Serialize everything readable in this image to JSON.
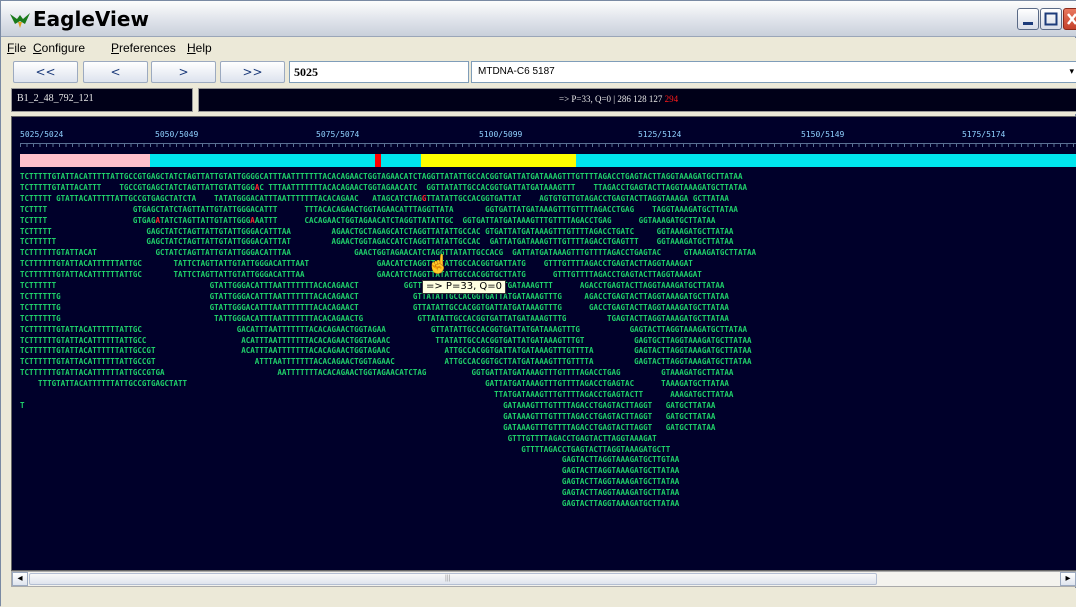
{
  "window": {
    "title": "EagleView"
  },
  "menu": {
    "file": "File",
    "configure": "Configure",
    "preferences": "Preferences",
    "help": "Help"
  },
  "nav": {
    "first_label": "<<",
    "prev_label": "<",
    "next_label": ">",
    "last_label": ">>",
    "position_value": "5025",
    "reference_value": "MTDNA-C6 5187"
  },
  "info": {
    "read_id": "B1_2_48_792_121",
    "status_main": "=> P=33, Q=0 |  286 128 127 ",
    "status_highlight": "294"
  },
  "positions": [
    "5025/5024",
    "5050/5049",
    "5075/5074",
    "5100/5099",
    "5125/5124",
    "5150/5149",
    "5175/5174"
  ],
  "coverage_colors": {
    "pink": "#ffc0cb",
    "cyan": "#00e5ee",
    "red": "#ff0000",
    "yellow": "#ffff00"
  },
  "tooltip": "=> P=33, Q=0",
  "reads": [
    {
      "t": "TCTTTTTGTATTACATTTTTATTGCCGTGAGCTATCTAGTTATTGTATTGGGGCATTTAATTTTTTTACACAGAACTGGTAGAACATCTAGGTTATATTGCCACGGTGATTATGATAAAGTTTGTTTTAGACCTGAGTACTTAGGTAAAGATGCTTATAA"
    },
    {
      "t": "TCTTTTTGTATTACATTT    TGCCGTGAGCTATCTAGTTATTGTATTGGGAC TTTAATTTTTTTACACAGAACTGGTAGAACATC  GGTTATATTGCCACGGTGATTATGATAAAGTTT    TTAGACCTGAGTACTTAGGTAAAGATGCTTATAA",
      "mm": [
        52
      ]
    },
    {
      "t": "TCTTTTT GTATTACATTTTTATTGCCGTGAGCTATCTA    TATATGGGACATTTAATTTTTTTACACAGAAC   ATAGCATCTAGGTTATATTGCCACGGTGATTAT    AGTGTGTTGTAGACCTGAGTACTTAGGTAAAGA GCTTATAA",
      "mm": [
        42,
        89
      ]
    },
    {
      "t": "TCTTTT                   GTGAGCTATCTAGTTATTGTATTGGGACATTT      TTTACACAGAACTGGTAGAACATTTAGGTTATA       GGTGATTATGATAAAGTTTGTTTTAGACCTGAG    TAGGTAAAGATGCTTATAA"
    },
    {
      "t": "TCTTTT                   GTGAGATATCTAGTTATTGTATTGGGAAATTT      CACAGAACTGGTAGAACATCTAGGTTATATTGC  GGTGATTATGATAAAGTTTGTTTTAGACCTGAG      GGTAAAGATGCTTATAA",
      "mm": [
        30,
        51
      ]
    },
    {
      "t": "TCTTTTT                     GAGCTATCTAGTTATTGTATTGGGACATTTAA         AGAACTGCTAGAGCATCTAGGTTATATTGCCAC GTGATTATGATAAAGTTTGTTTTAGACCTGATC     GGTAAAGATGCTTATAA"
    },
    {
      "t": "TCTTTTTT                    GAGCTATCTAGTTATTGTATTGGGACATTTAT         AGAACTGGTAGACCATCTAGGTTATATTGCCAC  GATTATGATAAAGTTTGTTTTAGACCTGAGTTT    GGTAAAGATGCTTATAA"
    },
    {
      "t": "TCTTTTTTGTATTACAT             GCTATCTAGTTATTGTATTGGGACATTTAA              GAACTGGTAGAACATCTAGGTTATATTGCCACG  GATTATGATAAAGTTTGTTTTAGACCTGAGTAC     GTAAAGATGCTTATAA"
    },
    {
      "t": "TCTTTTTTGTATTACATTTTTTATTGC       TATTCTAGTTATTGTATTGGGACATTTAAT               GAACATCTAGGTTATATTGCCACGGTGATTATG    GTTTGTTTTAGACCTGAGTACTTAGGTAAAGAT"
    },
    {
      "t": "TCTTTTTTGTATTACATTTTTTATTGC       TATTCTAGTTATTGTATTGGGACATTTAA                GAACATCTAGGTTATATTGCCACGGTGCTTATG      GTTTGTTTTAGACCTGAGTACTTAGGTAAAGAT"
    },
    {
      "t": "TCTTTTTT                                  GTATTGGGACATTTAATTTTTTTACACAGAACT          GGTTATATTGCCACGGTGATTATGATAAAGTTT      AGACCTGAGTACTTAGGTAAAGATGCTTATAA"
    },
    {
      "t": "TCTTTTTTG                                 GTATTGGGACATTTAATTTTTTTACACAGAACT            GTTATATTGCCACGGTGATTATGATAAAGTTTG     AGACCTGAGTACTTAGGTAAAGATGCTTATAA"
    },
    {
      "t": "TCTTTTTTG                                 GTATTGGGACATTTAATTTTTTTACACAGAACT            GTTATATTGCCACGGTGATTATGATAAAGTTTG      GACCTGAGTACTTAGGTAAAGATGCTTATAA"
    },
    {
      "t": "TCTTTTTTG                                  TATTGGGACATTTAATTTTTTTACACAGAACTG            GTTATATTGCCACGGTGATTATGATAAAGTTTG         TGAGTACTTAGGTAAAGATGCTTATAA"
    },
    {
      "t": "TCTTTTTTGTATTACATTTTTTATTGC                     GACATTTAATTTTTTTACACAGAACTGGTAGAA          GTTATATTGCCACGGTGATTATGATAAAGTTTG           GAGTACTTAGGTAAAGATGCTTATAA"
    },
    {
      "t": "TCTTTTTTGTATTACATTTTTTATTGCC                     ACATTTAATTTTTTTACACAGAACTGGTAGAAC          TTATATTGCCACGGTGATTATGATAAAGTTTGT           GAGTGCTTAGGTAAAGATGCTTATAA"
    },
    {
      "t": "TCTTTTTTGTATTACATTTTTTATTGCCGT                   ACATTTAATTTTTTTACACAGAACTGGTAGAAC            ATTGCCACGGTGATTATGATAAAGTTTGTTTTA         GAGTACTTAGGTAAAGATGCTTATAA"
    },
    {
      "t": "TCTTTTTTGTATTACATTTTTTATTGCCGT                      ATTTAATTTTTTTACACAGAACTGGTAGAAC           ATTGCCACGGTGCTTATGATAAAGTTTGTTTTA         GAGTACTTAGGTAAAGATGCTTATAA"
    },
    {
      "t": "TCTTTTTTGTATTACATTTTTTATTGCCGTGA                         AATTTTTTTACACAGAACTGGTAGAACATCTAG          GGTGATTATGATAAAGTTTGTTTTAGACCTGAG         GTAAAGATGCTTATAA"
    },
    {
      "t": "    TTTGTATTACATTTTTTATTGCCGTGAGCTATT                                                                  GATTATGATAAAGTTTGTTTTAGACCTGAGTAC      TAAAGATGCTTATAA"
    },
    {
      "t": "                                                                                                         TTATGATAAAGTTTGTTTTAGACCTGAGTACTT      AAAGATGCTTATAA"
    },
    {
      "t": "T                                                                                                          GATAAAGTTTGTTTTAGACCTGAGTACTTAGGT   GATGCTTATAA"
    },
    {
      "t": "                                                                                                           GATAAAGTTTGTTTTAGACCTGAGTACTTAGGT   GATGCTTATAA"
    },
    {
      "t": "                                                                                                           GATAAAGTTTGTTTTAGACCTGAGTACTTAGGT   GATGCTTATAA"
    },
    {
      "t": "                                                                                                            GTTTGTTTTAGACCTGAGTACTTAGGTAAAGAT"
    },
    {
      "t": "                                                                                                               GTTTTAGACCTGAGTACTTAGGTAAAGATGCTT"
    },
    {
      "t": "                                                                                                                        GAGTACTTAGGTAAAGATGCTTGTAA"
    },
    {
      "t": "                                                                                                                        GAGTACTTAGGTAAAGATGCTTATAA"
    },
    {
      "t": "                                                                                                                        GAGTACTTAGGTAAAGATGCTTATAA"
    },
    {
      "t": "                                                                                                                        GAGTACTTAGGTAAAGATGCTTATAA"
    },
    {
      "t": "                                                                                                                        GAGTACTTAGGTAAAGATGCTTATAA"
    }
  ]
}
